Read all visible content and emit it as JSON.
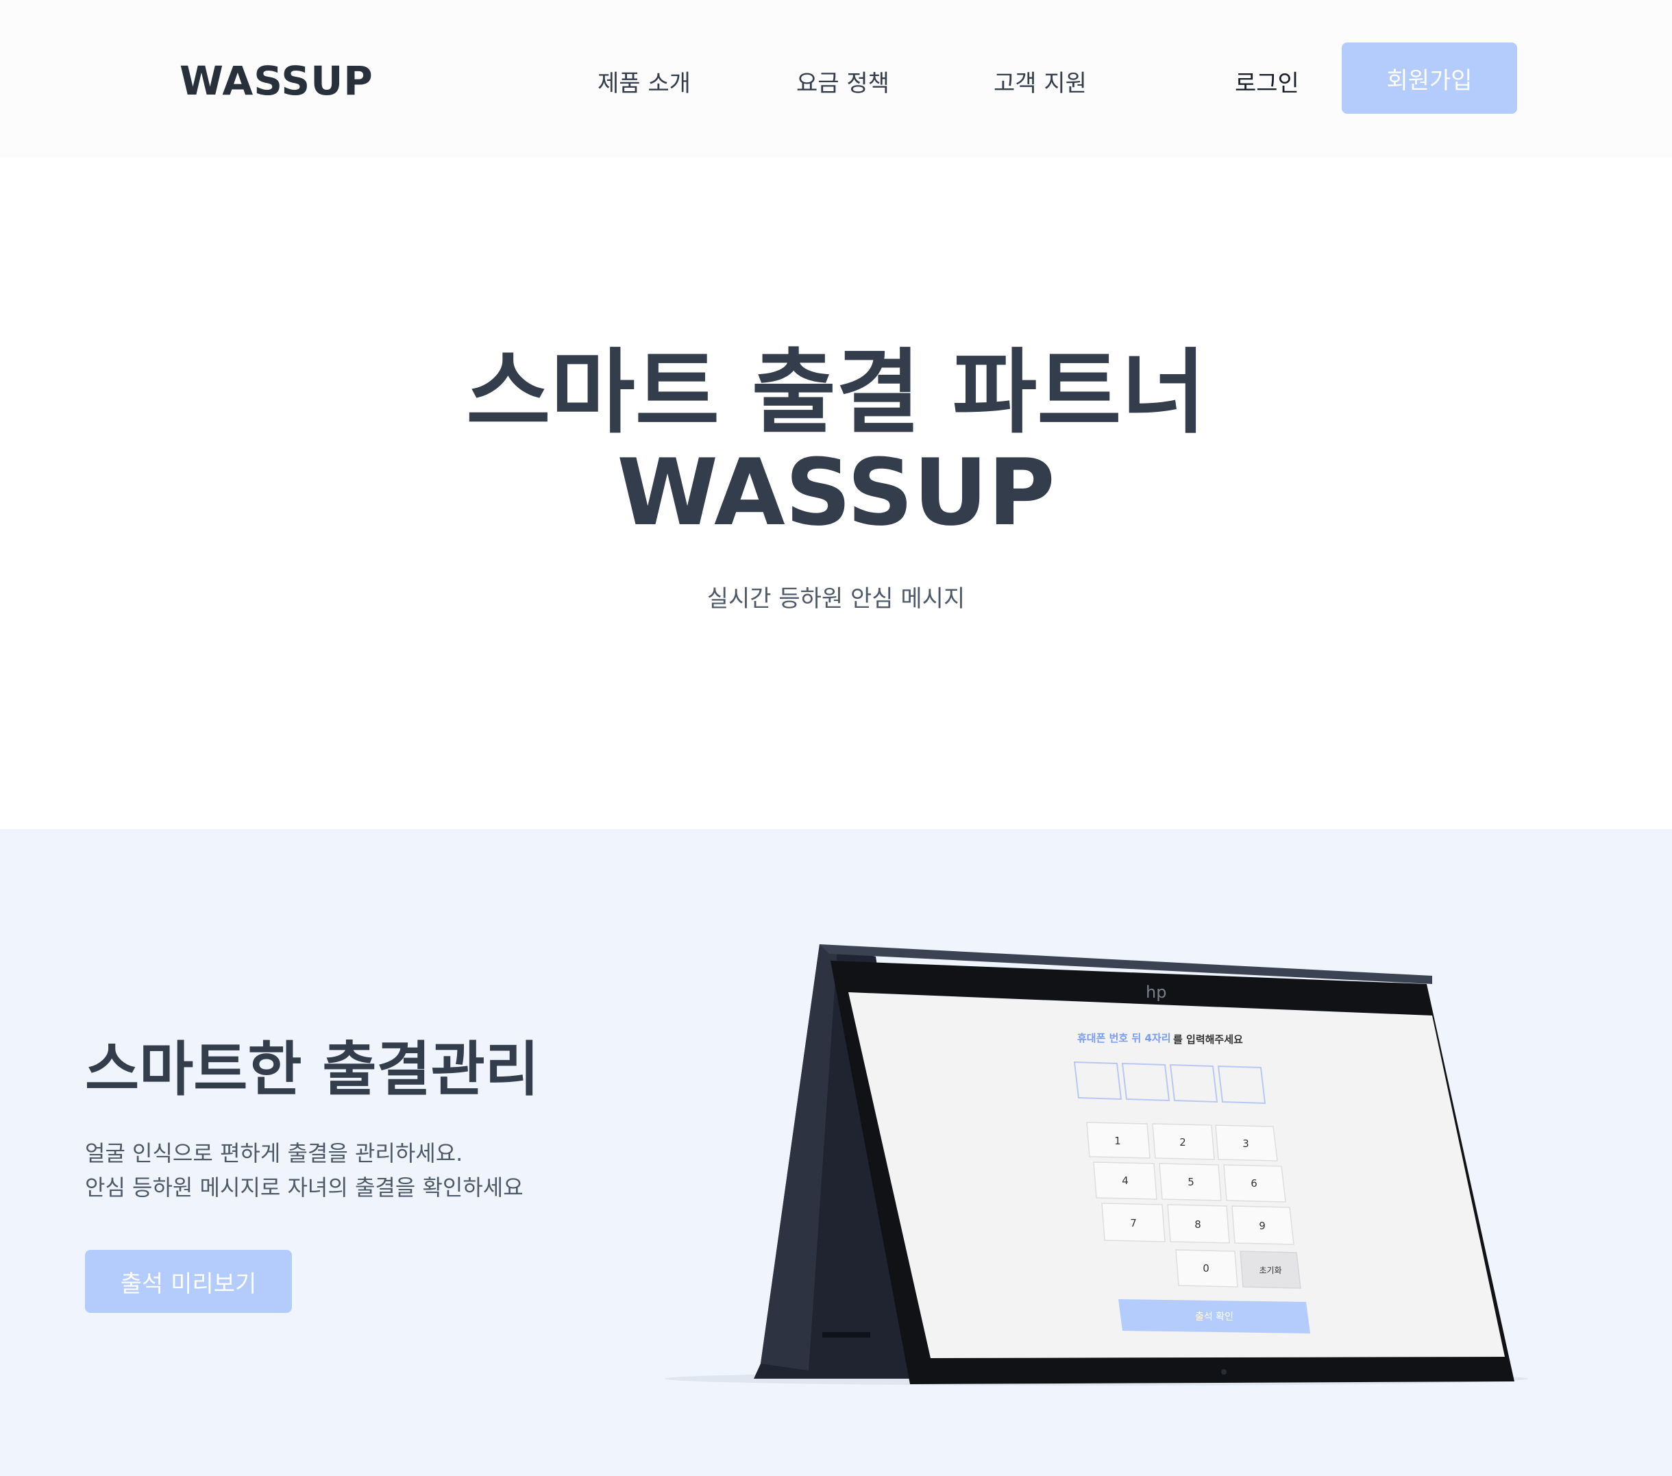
{
  "header": {
    "logo": "WASSUP",
    "nav": [
      "제품 소개",
      "요금 정책",
      "고객 지원"
    ],
    "login": "로그인",
    "signup": "회원가입"
  },
  "hero": {
    "title_line1": "스마트 출결 파트너",
    "title_line2": "WASSUP",
    "subtitle": "실시간 등하원 안심 메시지"
  },
  "feature": {
    "title": "스마트한 출결관리",
    "desc_line1": "얼굴 인식으로 편하게 출결을 관리하세요.",
    "desc_line2": "안심 등하원 메시지로 자녀의 출결을 확인하세요",
    "button": "출석 미리보기"
  },
  "device_screen": {
    "prompt_highlight": "휴대폰 번호 뒤 4자리",
    "prompt_rest": "를 입력해주세요",
    "keys": [
      "1",
      "2",
      "3",
      "4",
      "5",
      "6",
      "7",
      "8",
      "9",
      "0"
    ],
    "reset": "초기화",
    "confirm": "출석 확인"
  },
  "colors": {
    "accent": "#b4ccfb",
    "text": "#333d4b",
    "section_bg": "#eff4fd"
  }
}
